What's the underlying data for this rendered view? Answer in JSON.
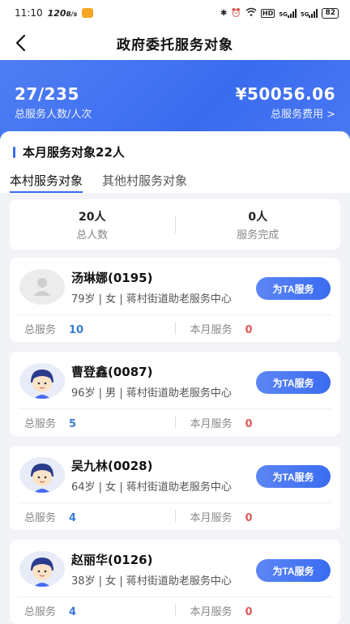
{
  "status_bar": {
    "time": "11:10",
    "net_speed": "120",
    "net_unit": "B/s",
    "net1": "5G",
    "net2": "5G",
    "battery": "82"
  },
  "nav": {
    "title": "政府委托服务对象"
  },
  "banner": {
    "people": "27/235",
    "people_label": "总服务人数/人次",
    "fee": "¥50056.06",
    "fee_label": "总服务费用 >"
  },
  "section": {
    "title": "本月服务对象22人",
    "tabs": [
      {
        "label": "本村服务对象"
      },
      {
        "label": "其他村服务对象"
      }
    ]
  },
  "summary": {
    "total_value": "20人",
    "total_label": "总人数",
    "done_value": "0人",
    "done_label": "服务完成"
  },
  "cards": [
    {
      "name": "汤琳娜(0195)",
      "info": "79岁 | 女 | 蒋村街道助老服务中心",
      "button": "为TA服务",
      "total_label": "总服务",
      "total": "10",
      "month_label": "本月服务",
      "month": "0",
      "avatar": "default-avatar-icon"
    },
    {
      "name": "曹登鑫(0087)",
      "info": "96岁 | 男 | 蒋村街道助老服务中心",
      "button": "为TA服务",
      "total_label": "总服务",
      "total": "5",
      "month_label": "本月服务",
      "month": "0",
      "avatar": "elder-avatar-icon"
    },
    {
      "name": "吴九林(0028)",
      "info": "64岁 | 女 | 蒋村街道助老服务中心",
      "button": "为TA服务",
      "total_label": "总服务",
      "total": "4",
      "month_label": "本月服务",
      "month": "0",
      "avatar": "elder-avatar-icon"
    },
    {
      "name": "赵丽华(0126)",
      "info": "38岁 | 女 | 蒋村街道助老服务中心",
      "button": "为TA服务",
      "total_label": "总服务",
      "total": "4",
      "month_label": "本月服务",
      "month": "0",
      "avatar": "elder-avatar-icon"
    }
  ],
  "colors": {
    "accent": "#3a6cf0",
    "total_value": "#3a7bd5",
    "month_value": "#e05a5a"
  }
}
